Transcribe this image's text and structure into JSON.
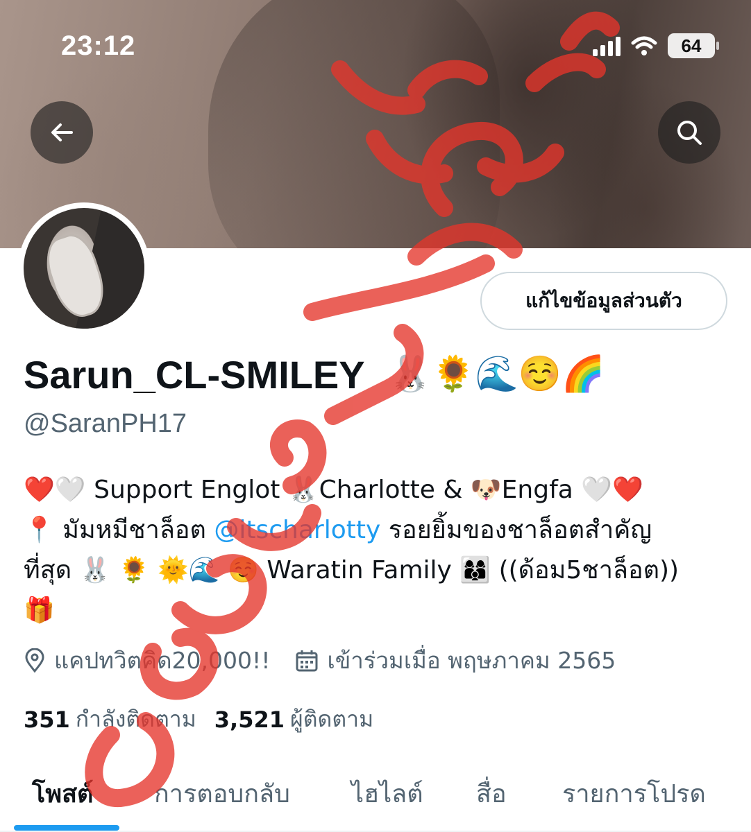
{
  "status_bar": {
    "time": "23:12",
    "battery": "64"
  },
  "header": {
    "back_icon": "arrow-left-icon",
    "search_icon": "search-icon"
  },
  "profile": {
    "edit_button_label": "แก้ไขข้อมูลส่วนตัว",
    "display_name": "Sarun_CL-SMILEY",
    "display_name_emojis": "🐰🌻🌊☺️🌈",
    "handle": "@SaranPH17",
    "bio": {
      "line1": "❤️🤍 Support Englot 🐰Charlotte & 🐶Engfa 🤍❤️",
      "line2_prefix": "📍 มัมหมีชาล็อต ",
      "line2_mention": "@itscharlotty",
      "line2_suffix": " รอยยิ้มของชาล็อตสำคัญ",
      "line3": "ที่สุด 🐰 🌻 🌞🌊 ☺️ Waratin Family 👩‍👩‍👦 ((ด้อม5ชาล็อต))",
      "line4": "🎁"
    },
    "location": "แคปทวิตคิด20,000!!",
    "joined": "เข้าร่วมเมื่อ พฤษภาคม 2565",
    "following_count": "351",
    "following_label": "กำลังติดตาม",
    "followers_count": "3,521",
    "followers_label": "ผู้ติดตาม"
  },
  "tabs": [
    {
      "label": "โพสต์",
      "active": true
    },
    {
      "label": "การตอบกลับ",
      "active": false
    },
    {
      "label": "ไฮไลต์",
      "active": false
    },
    {
      "label": "สื่อ",
      "active": false
    },
    {
      "label": "รายการโปรด",
      "active": false
    }
  ],
  "colors": {
    "accent": "#1d9bf0",
    "text_primary": "#0f1419",
    "text_secondary": "#536471",
    "stamp_red": "#e5352b"
  }
}
